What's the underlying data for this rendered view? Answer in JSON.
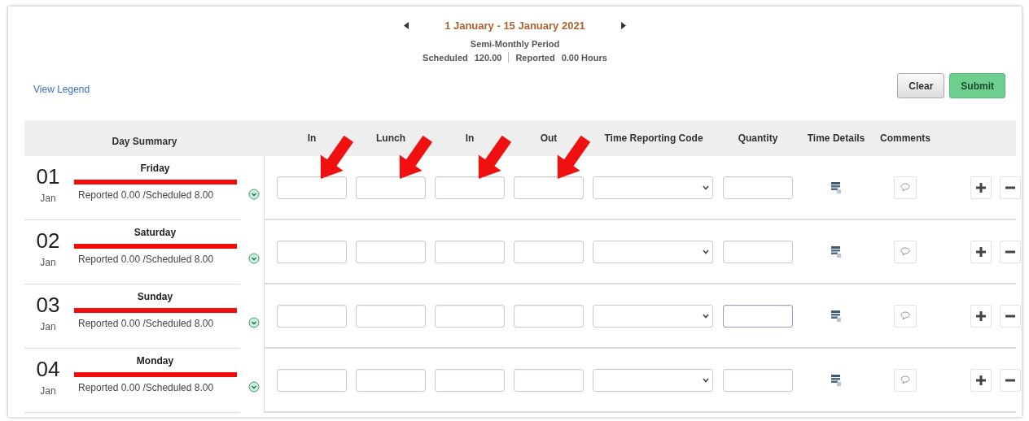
{
  "period": {
    "title": "1 January - 15 January 2021",
    "subtitle": "Semi-Monthly Period",
    "scheduled_label": "Scheduled",
    "scheduled_value": "120.00",
    "reported_label": "Reported",
    "reported_value": "0.00 Hours"
  },
  "legend_link": "View Legend",
  "buttons": [
    {
      "label": "Clear",
      "kind": "secondary"
    },
    {
      "label": "Submit",
      "kind": "primary"
    }
  ],
  "columns": [
    {
      "label": "Day Summary",
      "kind": "summary",
      "arrow": false
    },
    {
      "label": "In",
      "kind": "time",
      "arrow": true
    },
    {
      "label": "Lunch",
      "kind": "time",
      "arrow": true
    },
    {
      "label": "In",
      "kind": "time",
      "arrow": true
    },
    {
      "label": "Out",
      "kind": "time",
      "arrow": true
    },
    {
      "label": "Time Reporting Code",
      "kind": "select",
      "arrow": false
    },
    {
      "label": "Quantity",
      "kind": "quantity",
      "arrow": false
    },
    {
      "label": "Time Details",
      "kind": "details",
      "arrow": false
    },
    {
      "label": "Comments",
      "kind": "comments",
      "arrow": false
    }
  ],
  "rows": [
    {
      "day": "01",
      "month": "Jan",
      "weekday": "Friday",
      "summary": "Reported 0.00 /Scheduled 8.00",
      "quantity_focused": false
    },
    {
      "day": "02",
      "month": "Jan",
      "weekday": "Saturday",
      "summary": "Reported 0.00 /Scheduled 8.00",
      "quantity_focused": false
    },
    {
      "day": "03",
      "month": "Jan",
      "weekday": "Sunday",
      "summary": "Reported 0.00 /Scheduled 8.00",
      "quantity_focused": true
    },
    {
      "day": "04",
      "month": "Jan",
      "weekday": "Monday",
      "summary": "Reported 0.00 /Scheduled 8.00",
      "quantity_focused": false
    }
  ]
}
